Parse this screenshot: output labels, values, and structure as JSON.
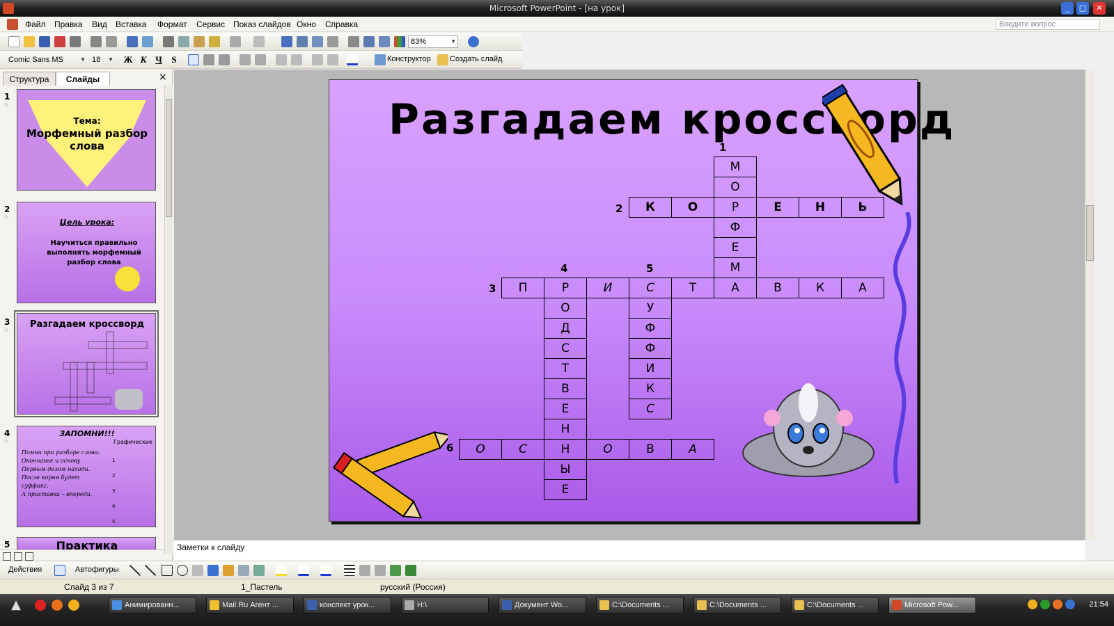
{
  "window": {
    "title": "Microsoft PowerPoint - [на урок]"
  },
  "menu": {
    "items": [
      "Файл",
      "Правка",
      "Вид",
      "Вставка",
      "Формат",
      "Сервис",
      "Показ слайдов",
      "Окно",
      "Справка"
    ],
    "help_placeholder": "Введите вопрос"
  },
  "toolbar": {
    "zoom": "83%"
  },
  "format_toolbar": {
    "font": "Comic Sans MS",
    "size": "18",
    "bold": "Ж",
    "italic": "К",
    "underline": "Ч",
    "shadow": "S",
    "designer": "Конструктор",
    "new_slide": "Создать слайд"
  },
  "panel": {
    "tabs": [
      "Структура",
      "Слайды"
    ],
    "close": "×",
    "thumbs": [
      {
        "num": "1",
        "label": "Тема:",
        "title": "Морфемный разбор слова"
      },
      {
        "num": "2",
        "label": "Цель урока:",
        "text": "Научиться правильно выполнять морфемный разбор слова"
      },
      {
        "num": "3",
        "title": "Разгадаем кроссворд"
      },
      {
        "num": "4",
        "title": "ЗАПОМНИ!!!",
        "side": "Графические",
        "poem": [
          "Помни при разборе слова:",
          "Окончанье и основу",
          "Первым делом находи.",
          "После корня будет",
          "суффикс,",
          "А приставка – впереди."
        ],
        "marks": [
          "1",
          "2",
          "3",
          "4",
          "5"
        ]
      },
      {
        "num": "5",
        "title": "Практика"
      }
    ]
  },
  "slide": {
    "title": "Разгадаем кроссворд",
    "clue_numbers": [
      "1",
      "2",
      "3",
      "4",
      "5",
      "6"
    ],
    "word1": [
      "М",
      "О",
      "Р",
      "Ф",
      "Е",
      "М",
      "А"
    ],
    "word2": [
      "К",
      "О",
      "Р",
      "Е",
      "Н",
      "Ь"
    ],
    "word3": [
      "П",
      "Р",
      "И",
      "С",
      "Т",
      "А",
      "В",
      "К",
      "А"
    ],
    "word4": [
      "Р",
      "О",
      "Д",
      "С",
      "Т",
      "В",
      "Е",
      "Н",
      "Н",
      "Ы",
      "Е"
    ],
    "word5": [
      "С",
      "У",
      "Ф",
      "Ф",
      "И",
      "К",
      "С"
    ],
    "word6": [
      "О",
      "С",
      "Н",
      "О",
      "В",
      "А"
    ]
  },
  "notes": {
    "placeholder": "Заметки к слайду"
  },
  "drawing": {
    "actions": "Действия",
    "autoshapes": "Автофигуры"
  },
  "status": {
    "slide": "Слайд 3 из 7",
    "design": "1_Пастель",
    "language": "русский (Россия)"
  },
  "taskbar": {
    "items": [
      "Анимированн...",
      "Mail.Ru Агент ...",
      "конспект урок...",
      "H:\\",
      "Документ Wo...",
      "C:\\Documents ...",
      "C:\\Documents ...",
      "C:\\Documents ...",
      "Microsoft Pow..."
    ],
    "clock": "21:54"
  },
  "colors": {
    "slide_top": "#d9a1ff",
    "slide_bottom": "#a95ae8",
    "pencil": "#f5b820",
    "squiggle": "#5a3de0"
  }
}
